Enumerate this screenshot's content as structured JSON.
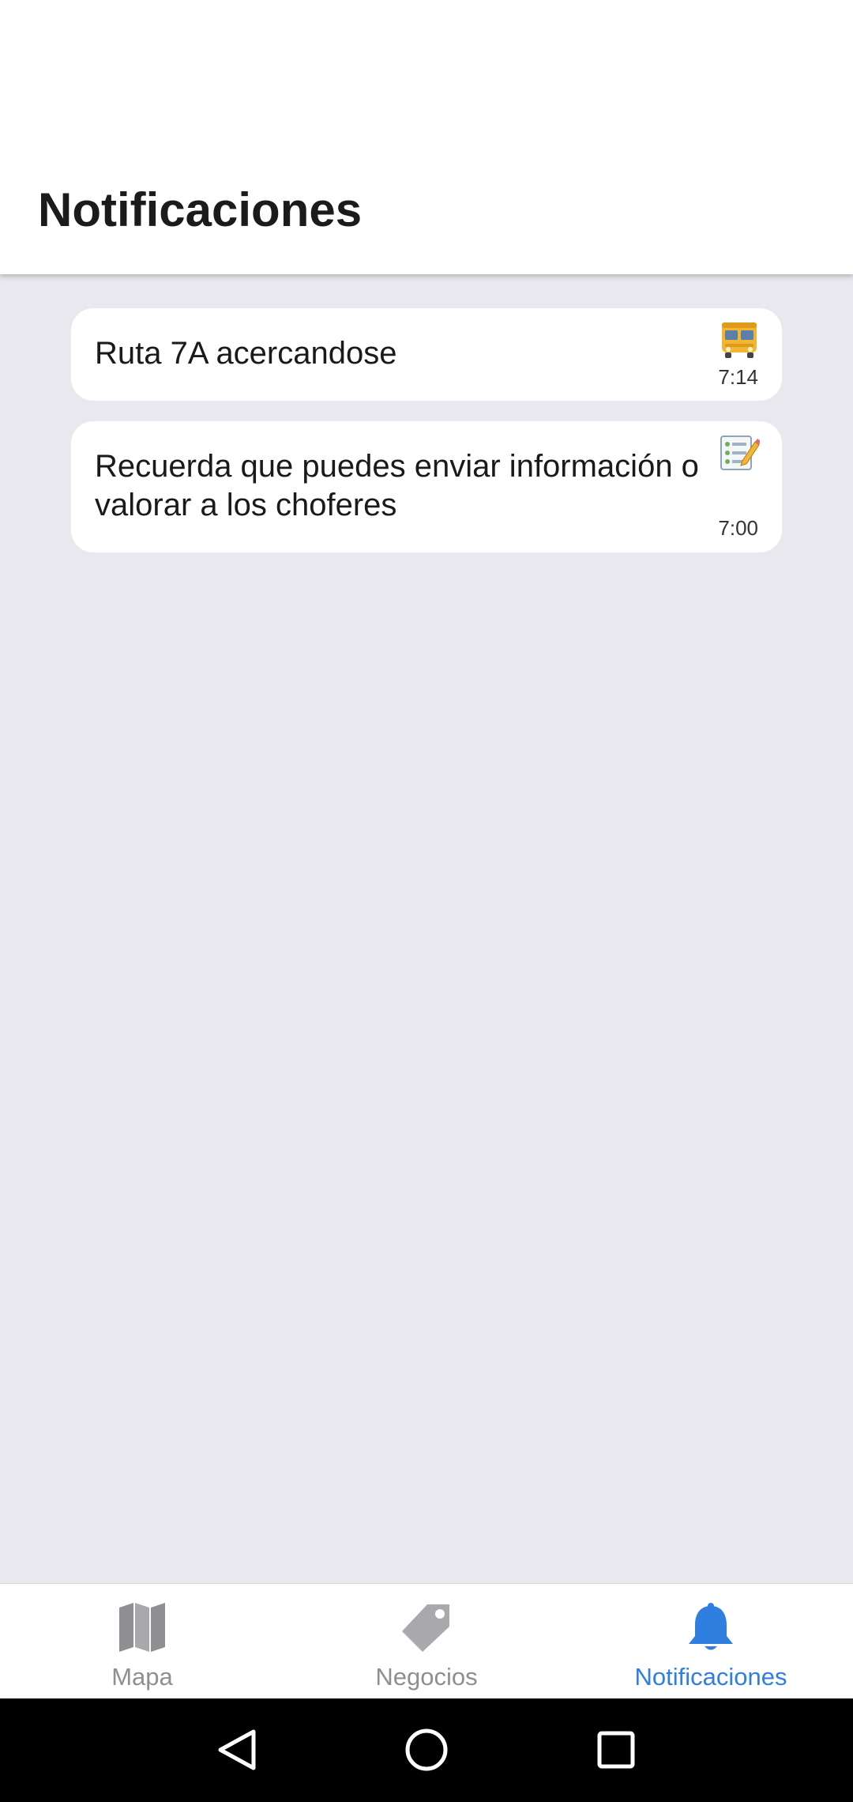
{
  "header": {
    "title": "Notificaciones"
  },
  "notifications": [
    {
      "message": "Ruta 7A acercandose",
      "time": "7:14",
      "icon": "bus-icon"
    },
    {
      "message": "Recuerda que puedes enviar información o valorar a los choferes",
      "time": "7:00",
      "icon": "checklist-edit-icon"
    }
  ],
  "tabs": [
    {
      "label": "Mapa",
      "icon": "map-icon",
      "active": false
    },
    {
      "label": "Negocios",
      "icon": "tag-icon",
      "active": false
    },
    {
      "label": "Notificaciones",
      "icon": "bell-icon",
      "active": true
    }
  ],
  "colors": {
    "accent": "#2f7fe0",
    "inactive": "#8e8e93",
    "background": "#e8e8ee"
  },
  "system_nav": [
    "back-icon",
    "home-icon",
    "recents-icon"
  ]
}
